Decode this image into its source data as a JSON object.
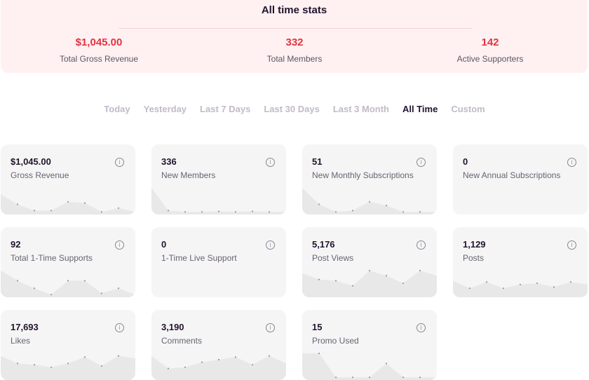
{
  "all_time_stats": {
    "title": "All time stats",
    "items": [
      {
        "value": "$1,045.00",
        "label": "Total Gross Revenue"
      },
      {
        "value": "332",
        "label": "Total Members"
      },
      {
        "value": "142",
        "label": "Active Supporters"
      }
    ]
  },
  "tabs": [
    {
      "label": "Today",
      "active": false
    },
    {
      "label": "Yesterday",
      "active": false
    },
    {
      "label": "Last 7 Days",
      "active": false
    },
    {
      "label": "Last 30 Days",
      "active": false
    },
    {
      "label": "Last 3 Month",
      "active": false
    },
    {
      "label": "All Time",
      "active": true
    },
    {
      "label": "Custom",
      "active": false
    }
  ],
  "cards": [
    {
      "value": "$1,045.00",
      "label": "Gross Revenue",
      "info_icon": "info-icon",
      "trend": [
        0.75,
        0.35,
        0.1,
        0.1,
        0.45,
        0.4,
        0.05,
        0.2,
        0.05
      ]
    },
    {
      "value": "336",
      "label": "New Members",
      "info_icon": "info-icon",
      "trend": [
        1.0,
        0.1,
        0.05,
        0.05,
        0.07,
        0.05,
        0.07,
        0.05,
        0.05
      ]
    },
    {
      "value": "51",
      "label": "New Monthly Subscriptions",
      "info_icon": "info-icon",
      "trend": [
        1.0,
        0.35,
        0.05,
        0.1,
        0.45,
        0.3,
        0.05,
        0.05,
        0.05
      ]
    },
    {
      "value": "0",
      "label": "New Annual Subscriptions",
      "info_icon": "info-icon",
      "trend": []
    },
    {
      "value": "92",
      "label": "Total 1-Time Supports",
      "info_icon": "info-icon",
      "trend": [
        1.0,
        0.6,
        0.3,
        0.05,
        0.6,
        0.6,
        0.1,
        0.3,
        0.05
      ]
    },
    {
      "value": "0",
      "label": "1-Time Live Support",
      "info_icon": "info-icon",
      "trend": []
    },
    {
      "value": "5,176",
      "label": "Post Views",
      "info_icon": "info-icon",
      "trend": [
        0.9,
        0.65,
        0.6,
        0.4,
        1.0,
        0.8,
        0.5,
        1.0,
        0.8
      ]
    },
    {
      "value": "1,129",
      "label": "Posts",
      "info_icon": "info-icon",
      "trend": [
        0.6,
        0.3,
        0.55,
        0.3,
        0.45,
        0.5,
        0.35,
        0.55,
        0.45
      ]
    },
    {
      "value": "17,693",
      "label": "Likes",
      "info_icon": "info-icon",
      "trend": [
        0.9,
        0.6,
        0.55,
        0.45,
        0.6,
        0.85,
        0.5,
        0.9,
        0.8
      ]
    },
    {
      "value": "3,190",
      "label": "Comments",
      "info_icon": "info-icon",
      "trend": [
        0.9,
        0.4,
        0.45,
        0.65,
        0.75,
        0.85,
        0.55,
        0.9,
        0.6
      ]
    },
    {
      "value": "15",
      "label": "Promo Used",
      "info_icon": "info-icon",
      "trend": [
        1.0,
        1.0,
        0.05,
        0.05,
        0.05,
        0.6,
        0.05,
        0.05,
        0.05
      ]
    }
  ],
  "colors": {
    "accent": "#e3333f",
    "card_bg": "#f5f5f5",
    "chart_fill": "#e8e8e8",
    "chart_dot": "#9a9a9a"
  }
}
